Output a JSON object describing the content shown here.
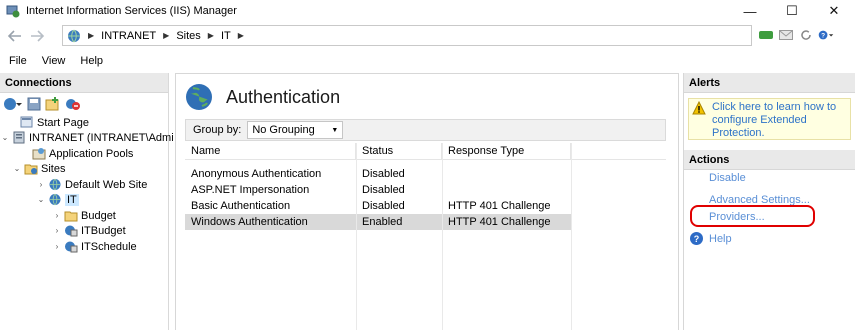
{
  "window": {
    "title": "Internet Information Services (IIS) Manager",
    "controls": {
      "minimize": "—",
      "maximize": "☐",
      "close": "✕"
    }
  },
  "address": {
    "back_icon": "back-arrow-icon",
    "forward_icon": "forward-arrow-icon",
    "crumbs": [
      "INTRANET",
      "Sites",
      "IT"
    ]
  },
  "menu": {
    "items": [
      "File",
      "View",
      "Help"
    ]
  },
  "connections": {
    "header": "Connections",
    "tree": [
      {
        "label": "Start Page",
        "icon": "start-page-icon"
      },
      {
        "label": "INTRANET (INTRANET\\Admi",
        "icon": "server-icon"
      },
      {
        "label": "Application Pools",
        "icon": "app-pools-icon"
      },
      {
        "label": "Sites",
        "icon": "sites-folder-icon"
      },
      {
        "label": "Default Web Site",
        "icon": "globe-icon"
      },
      {
        "label": "IT",
        "icon": "globe-icon"
      },
      {
        "label": "Budget",
        "icon": "folder-icon"
      },
      {
        "label": "ITBudget",
        "icon": "application-icon"
      },
      {
        "label": "ITSchedule",
        "icon": "application-icon"
      }
    ]
  },
  "feature": {
    "title": "Authentication",
    "groupby_label": "Group by:",
    "groupby_value": "No Grouping",
    "columns": [
      "Name",
      "Status",
      "Response Type"
    ],
    "rows": [
      {
        "name": "Anonymous Authentication",
        "status": "Disabled",
        "response": ""
      },
      {
        "name": "ASP.NET Impersonation",
        "status": "Disabled",
        "response": ""
      },
      {
        "name": "Basic Authentication",
        "status": "Disabled",
        "response": "HTTP 401 Challenge"
      },
      {
        "name": "Windows Authentication",
        "status": "Enabled",
        "response": "HTTP 401 Challenge"
      }
    ]
  },
  "alerts": {
    "header": "Alerts",
    "message": "Click here to learn how to configure Extended Protection."
  },
  "actions": {
    "header": "Actions",
    "disable": "Disable",
    "advanced": "Advanced Settings...",
    "providers": "Providers...",
    "help": "Help"
  },
  "colors": {
    "link": "#5a8fd6",
    "alert_bg": "#ffffe1",
    "highlight": "#e00000",
    "selection": "#cce8ff"
  }
}
